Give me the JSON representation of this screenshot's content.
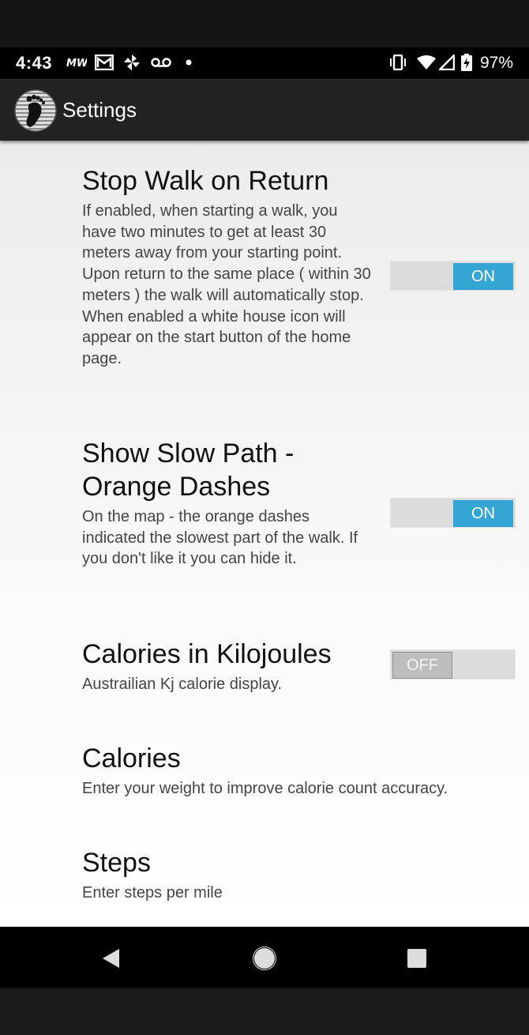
{
  "status_bar": {
    "time": "4:43",
    "battery": "97%",
    "icons": [
      "motorola-icon",
      "gmail-icon",
      "pinwheel-icon",
      "voicemail-icon",
      "dot-icon",
      "vibrate-icon",
      "wifi-icon",
      "signal-icon",
      "battery-charging-icon"
    ]
  },
  "app_bar": {
    "title": "Settings",
    "logo": "footprint-logo-icon"
  },
  "settings": [
    {
      "title": "Stop Walk on Return",
      "summary": "If enabled, when starting a walk, you have two minutes to get at least 30 meters away from your starting point. Upon return to the same place ( within 30 meters ) the walk will automatically stop. When enabled a white house icon will appear on the start button of the home page.",
      "toggle": "ON"
    },
    {
      "title": "Show Slow Path - Orange Dashes",
      "summary": "On the map - the orange dashes indicated the slowest part of the walk. If you don't like it you can hide it.",
      "toggle": "ON"
    },
    {
      "title": "Calories in Kilojoules",
      "summary": "Austrailian Kj calorie display.",
      "toggle": "OFF"
    },
    {
      "title": "Calories",
      "summary": "Enter your weight to improve calorie count accuracy."
    },
    {
      "title": "Steps",
      "summary": "Enter steps per mile"
    }
  ],
  "nav_bar": {
    "buttons": [
      "back-icon",
      "home-icon",
      "recents-icon"
    ]
  },
  "colors": {
    "toggle_on": "#33a6d4",
    "app_bar": "#222222",
    "status_bar": "#000000"
  }
}
